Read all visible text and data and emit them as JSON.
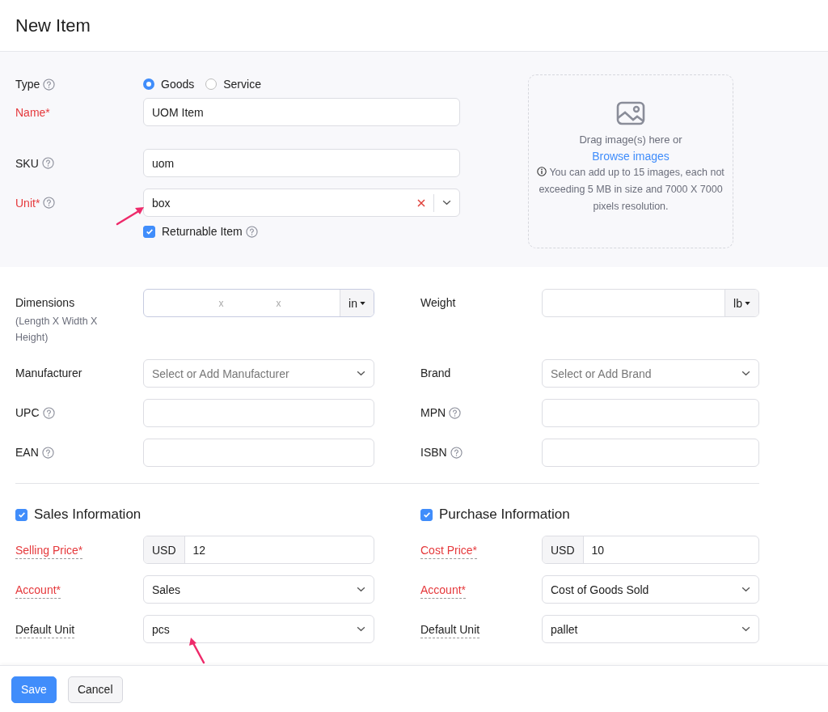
{
  "title": "New Item",
  "basic": [
    {
      "kind": "radio",
      "label": "Type",
      "help": true,
      "required": false,
      "options": [
        {
          "label": "Goods",
          "selected": true
        },
        {
          "label": "Service",
          "selected": false
        }
      ]
    },
    {
      "kind": "text",
      "label": "Name*",
      "help": false,
      "required": true,
      "value": "UOM Item"
    },
    {
      "kind": "text",
      "label": "SKU",
      "help": true,
      "required": false,
      "value": "uom"
    },
    {
      "kind": "clearable",
      "label": "Unit*",
      "help": true,
      "required": true,
      "value": "box",
      "pointer": true
    },
    {
      "kind": "checkbox",
      "label": "Returnable Item",
      "help": true,
      "checked": true
    }
  ],
  "uploader": {
    "drop_text": "Drag image(s) here or",
    "browse_link": "Browse images",
    "note": "You can add up to 15 images, each not exceeding 5 MB in size and 7000 X 7000 pixels resolution."
  },
  "details": [
    [
      {
        "kind": "dimensions",
        "label": "Dimensions",
        "hint": "(Length X Width X Height)",
        "separators": [
          "x",
          "x"
        ],
        "unit": "in"
      },
      {
        "kind": "unit",
        "label": "Weight",
        "unit": "lb"
      }
    ],
    [
      {
        "kind": "select",
        "label": "Manufacturer",
        "placeholder": "Select or Add Manufacturer"
      },
      {
        "kind": "select",
        "label": "Brand",
        "placeholder": "Select or Add Brand"
      }
    ],
    [
      {
        "kind": "text",
        "label": "UPC",
        "help": true
      },
      {
        "kind": "text",
        "label": "MPN",
        "help": true
      }
    ],
    [
      {
        "kind": "text",
        "label": "EAN",
        "help": true
      },
      {
        "kind": "text",
        "label": "ISBN",
        "help": true
      }
    ]
  ],
  "sections": [
    {
      "title": "Sales Information",
      "checked": true,
      "fields": [
        {
          "kind": "currency",
          "label": "Selling Price*",
          "required": true,
          "currency": "USD",
          "value": "12"
        },
        {
          "kind": "select",
          "label": "Account*",
          "required": true,
          "value": "Sales"
        },
        {
          "kind": "select",
          "label": "Default Unit",
          "required": false,
          "value": "pcs",
          "pointer": true
        }
      ]
    },
    {
      "title": "Purchase Information",
      "checked": true,
      "fields": [
        {
          "kind": "currency",
          "label": "Cost Price*",
          "required": true,
          "currency": "USD",
          "value": "10"
        },
        {
          "kind": "select",
          "label": "Account*",
          "required": true,
          "value": "Cost of Goods Sold"
        },
        {
          "kind": "select",
          "label": "Default Unit",
          "required": false,
          "value": "pallet",
          "pointer": false
        }
      ]
    }
  ],
  "buttons": [
    {
      "label": "Save",
      "kind": "primary"
    },
    {
      "label": "Cancel",
      "kind": "secondary"
    }
  ]
}
